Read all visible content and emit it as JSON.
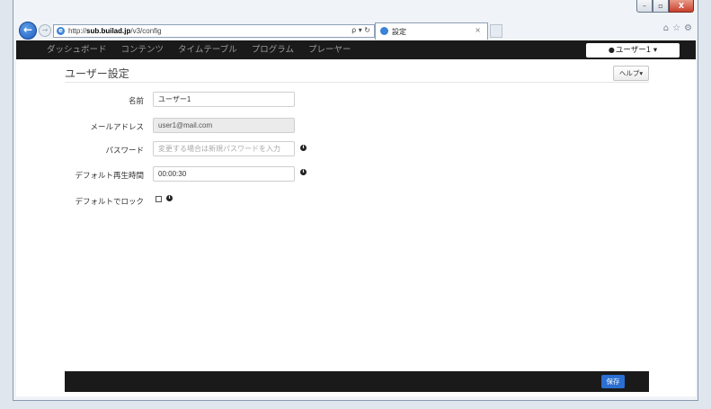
{
  "browser": {
    "url_prefix": "http://",
    "url_host": "sub.builad.jp",
    "url_path": "/v3/config",
    "addr_tools": "ρ ▾ ↻",
    "tab_title": "設定",
    "tab_close": "×",
    "caption": {
      "minimize": "–",
      "maximize": "▫",
      "close": "X"
    },
    "cmd_icons": [
      "⌂",
      "☆",
      "⚙"
    ]
  },
  "nav": {
    "items": [
      "ダッシュボード",
      "コンテンツ",
      "タイムテーブル",
      "プログラム",
      "プレーヤー"
    ],
    "user_label": "ユーザー1 ▾"
  },
  "page": {
    "title": "ユーザー設定",
    "help_label": "ヘルプ▾"
  },
  "form": {
    "name_label": "名前",
    "name_value": "ユーザー1",
    "email_label": "メールアドレス",
    "email_value": "user1@mail.com",
    "password_label": "パスワード",
    "password_placeholder": "変更する場合は新規パスワードを入力",
    "default_time_label": "デフォルト再生時間",
    "default_time_value": "00:00:30",
    "lock_label": "デフォルトでロック",
    "lock_checked": false
  },
  "footer": {
    "save_label": "保存"
  }
}
